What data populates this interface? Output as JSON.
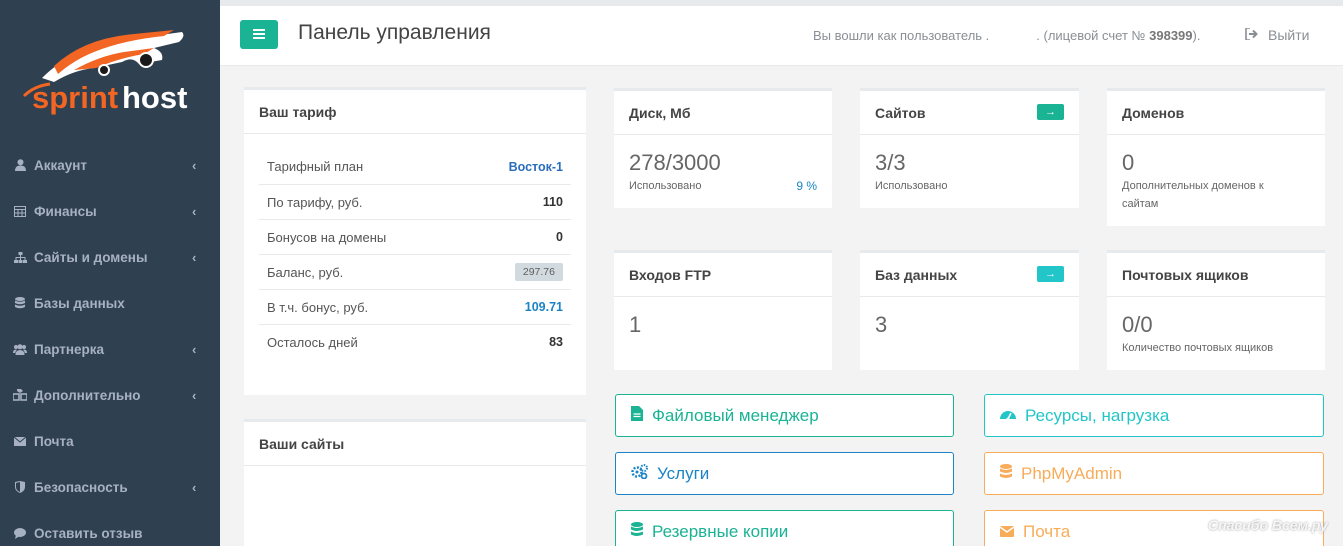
{
  "brand": {
    "name": "sprinthost",
    "primary_color": "#1ab394",
    "sidebar_color": "#2f4050"
  },
  "sidebar": {
    "items": [
      {
        "label": "Аккаунт",
        "icon": "user-icon",
        "has_submenu": true
      },
      {
        "label": "Финансы",
        "icon": "table-icon",
        "has_submenu": true
      },
      {
        "label": "Сайты и домены",
        "icon": "sitemap-icon",
        "has_submenu": true
      },
      {
        "label": "Базы данных",
        "icon": "database-icon",
        "has_submenu": false
      },
      {
        "label": "Партнерка",
        "icon": "users-icon",
        "has_submenu": true
      },
      {
        "label": "Дополнительно",
        "icon": "cubes-icon",
        "has_submenu": true
      },
      {
        "label": "Почта",
        "icon": "envelope-icon",
        "has_submenu": false
      },
      {
        "label": "Безопасность",
        "icon": "shield-icon",
        "has_submenu": true
      },
      {
        "label": "Оставить отзыв",
        "icon": "comment-icon",
        "has_submenu": false
      }
    ]
  },
  "header": {
    "title": "Панель управления",
    "user_prefix": "Вы вошли как пользователь .",
    "account_prefix": ". (лицевой счет №",
    "account_number": "398399",
    "account_suffix": ").",
    "logout_label": "Выйти"
  },
  "tariff": {
    "title": "Ваш тариф",
    "rows": [
      {
        "label": "Тарифный план",
        "value": "Восток-1"
      },
      {
        "label": "По тарифу, руб.",
        "value": "110"
      },
      {
        "label": "Бонусов на домены",
        "value": "0"
      },
      {
        "label": "Баланс, руб.",
        "value": "297.76"
      },
      {
        "label": "В т.ч. бонус, руб.",
        "value": "109.71"
      },
      {
        "label": "Осталось дней",
        "value": "83"
      }
    ]
  },
  "sites_panel": {
    "title": "Ваши сайты"
  },
  "stats": {
    "disk": {
      "title": "Диск, Мб",
      "value": "278/3000",
      "caption": "Использовано",
      "percent": "9 %"
    },
    "sites": {
      "title": "Сайтов",
      "value": "3/3",
      "caption": "Использовано"
    },
    "domains": {
      "title": "Доменов",
      "value": "0",
      "caption": "Дополнительных доменов к сайтам"
    },
    "ftp": {
      "title": "Входов FTP",
      "value": "1"
    },
    "databases": {
      "title": "Баз данных",
      "value": "3"
    },
    "mailboxes": {
      "title": "Почтовых ящиков",
      "value": "0/0",
      "caption": "Количество почтовых ящиков"
    }
  },
  "actions": {
    "file_manager": "Файловый менеджер",
    "resources": "Ресурсы, нагрузка",
    "services": "Услуги",
    "phpmyadmin": "PhpMyAdmin",
    "backups": "Резервные копии",
    "mail": "Почта"
  },
  "watermark": "Спасибо Всем.ру"
}
